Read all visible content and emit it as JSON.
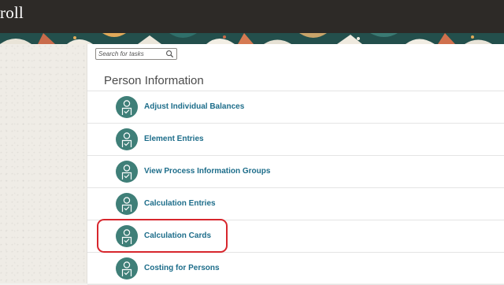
{
  "header": {
    "app_title": "roll"
  },
  "search": {
    "placeholder": "Search for tasks"
  },
  "section": {
    "title": "Person Information"
  },
  "tasks": [
    {
      "label": "Adjust Individual Balances",
      "icon": "person-document-icon"
    },
    {
      "label": "Element Entries",
      "icon": "person-document-icon"
    },
    {
      "label": "View Process Information Groups",
      "icon": "person-document-icon"
    },
    {
      "label": "Calculation Entries",
      "icon": "person-document-icon"
    },
    {
      "label": "Calculation Cards",
      "icon": "person-document-icon",
      "highlighted": true
    },
    {
      "label": "Costing for Persons",
      "icon": "person-document-icon"
    }
  ],
  "colors": {
    "header_bg": "#2d2a27",
    "icon_circle": "#3f7f78",
    "link": "#1d6d8a",
    "highlight": "#d7262d"
  }
}
